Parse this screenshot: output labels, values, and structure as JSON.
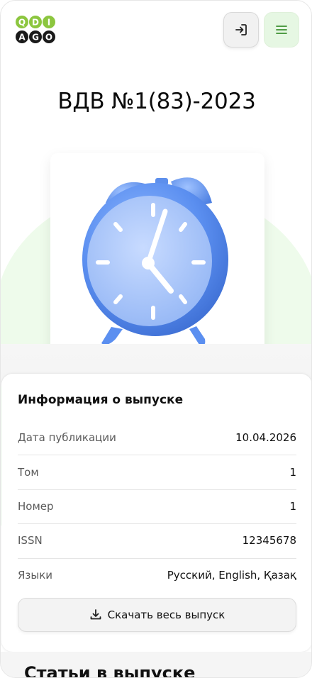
{
  "header": {
    "logo_letters": [
      "Q",
      "D",
      "I",
      "A",
      "G",
      "O"
    ],
    "login_icon": "login-icon",
    "menu_icon": "hamburger-menu-icon"
  },
  "issue": {
    "title": "ВДВ №1(83)-2023",
    "cover_icon": "alarm-clock-illustration"
  },
  "info": {
    "heading": "Информация о выпуске",
    "rows": [
      {
        "label": "Дата публикации",
        "value": "10.04.2026"
      },
      {
        "label": "Том",
        "value": "1"
      },
      {
        "label": "Номер",
        "value": "1"
      },
      {
        "label": "ISSN",
        "value": "12345678"
      },
      {
        "label": "Языки",
        "value": "Русский, English, Қазақ"
      }
    ],
    "download_label": "Скачать весь выпуск",
    "download_icon": "download-icon"
  },
  "articles": {
    "heading": "Статьи в выпуске"
  },
  "colors": {
    "accent_green": "#8cc63f",
    "menu_bg": "#e6f7e3",
    "clock_blue": "#5b8ff0"
  }
}
